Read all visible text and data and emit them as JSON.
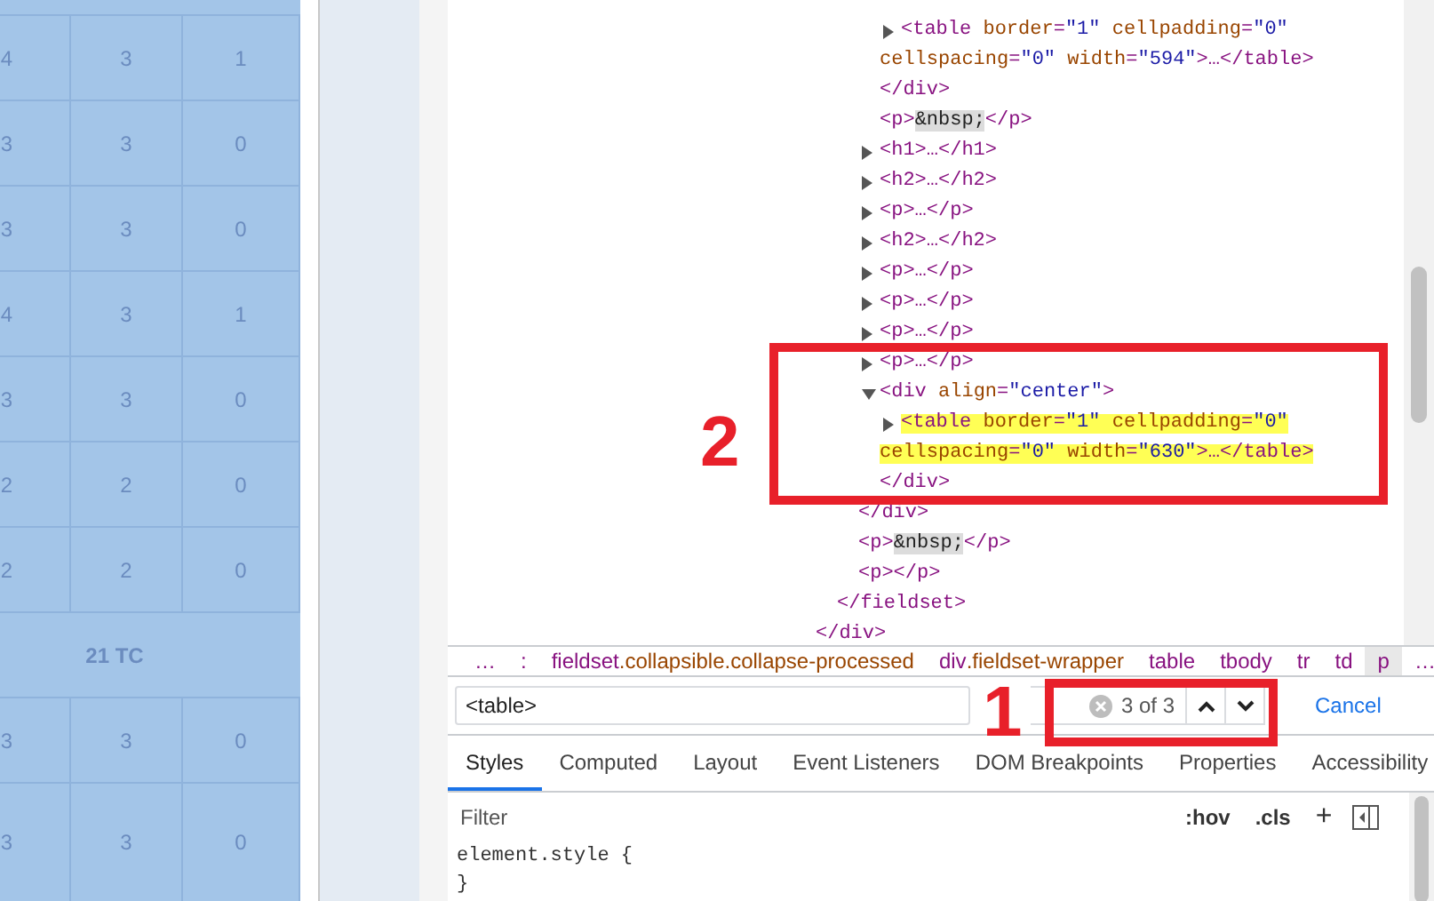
{
  "left_table": {
    "rows": [
      {
        "kind": "data",
        "cells": [
          "4",
          "3",
          "1"
        ]
      },
      {
        "kind": "data",
        "cells": [
          "3",
          "3",
          "0"
        ]
      },
      {
        "kind": "data",
        "cells": [
          "3",
          "3",
          "0"
        ]
      },
      {
        "kind": "data",
        "cells": [
          "4",
          "3",
          "1"
        ]
      },
      {
        "kind": "data",
        "cells": [
          "3",
          "3",
          "0"
        ]
      },
      {
        "kind": "data",
        "cells": [
          "2",
          "2",
          "0"
        ]
      },
      {
        "kind": "data",
        "cells": [
          "2",
          "2",
          "0"
        ]
      },
      {
        "kind": "group",
        "label": "21 TC"
      },
      {
        "kind": "data",
        "cells": [
          "3",
          "3",
          "0"
        ]
      },
      {
        "kind": "data",
        "cells": [
          "3",
          "3",
          "0"
        ]
      }
    ]
  },
  "dom_tree": [
    {
      "close": "</div>",
      "children": [
        {
          "close": "</fieldset>",
          "children": [
            {
              "close": "</div>",
              "children": [
                {
                  "close": "</div>",
                  "children": [
                    {
                      "open": [
                        "<table border=\"1\" cellpadding=\"0\"",
                        "cellspacing=\"0\" width=\"594\">…</table>"
                      ],
                      "expanded": false,
                      "search_match": false
                    }
                  ]
                },
                {
                  "open": [
                    "<p>&nbsp;</p>"
                  ]
                },
                {
                  "open": [
                    "<h1>…</h1>"
                  ],
                  "expanded": false
                },
                {
                  "open": [
                    "<h2>…</h2>"
                  ],
                  "expanded": false
                },
                {
                  "open": [
                    "<p>…</p>"
                  ],
                  "expanded": false
                },
                {
                  "open": [
                    "<h2>…</h2>"
                  ],
                  "expanded": false
                },
                {
                  "open": [
                    "<p>…</p>"
                  ],
                  "expanded": false
                },
                {
                  "open": [
                    "<p>…</p>"
                  ],
                  "expanded": false
                },
                {
                  "open": [
                    "<p>…</p>"
                  ],
                  "expanded": false
                },
                {
                  "open": [
                    "<p>…</p>"
                  ],
                  "expanded": false
                },
                {
                  "open": [
                    "<div align=\"center\">"
                  ],
                  "expanded": true,
                  "close": "</div>",
                  "children": [
                    {
                      "open": [
                        "<table border=\"1\" cellpadding=\"0\"",
                        "cellspacing=\"0\" width=\"630\">…</table>"
                      ],
                      "expanded": false,
                      "search_match": true
                    }
                  ]
                }
              ]
            },
            {
              "open": [
                "<p>&nbsp;</p>"
              ]
            },
            {
              "open": [
                "<p></p>"
              ]
            }
          ]
        }
      ]
    }
  ],
  "breadcrumbs": [
    {
      "label": "…",
      "selected": false
    },
    {
      "label": ":",
      "selected": false
    },
    {
      "label": "fieldset.collapsible.collapse-processed",
      "selected": false
    },
    {
      "label": "div.fieldset-wrapper",
      "selected": false
    },
    {
      "label": "table",
      "selected": false
    },
    {
      "label": "tbody",
      "selected": false
    },
    {
      "label": "tr",
      "selected": false
    },
    {
      "label": "td",
      "selected": false
    },
    {
      "label": "p",
      "selected": true
    },
    {
      "label": "…",
      "selected": false
    }
  ],
  "search": {
    "value": "<table>",
    "match_count": "3 of 3",
    "cancel": "Cancel"
  },
  "tabs": [
    {
      "label": "Styles",
      "selected": true
    },
    {
      "label": "Computed",
      "selected": false
    },
    {
      "label": "Layout",
      "selected": false
    },
    {
      "label": "Event Listeners",
      "selected": false
    },
    {
      "label": "DOM Breakpoints",
      "selected": false
    },
    {
      "label": "Properties",
      "selected": false
    },
    {
      "label": "Accessibility",
      "selected": false
    }
  ],
  "styles": {
    "filter_placeholder": "Filter",
    "toolbar": [
      ":hov",
      ".cls",
      "+"
    ],
    "rule": [
      "element.style {",
      "}"
    ]
  },
  "annotations": [
    {
      "label": "2"
    },
    {
      "label": "1"
    }
  ]
}
